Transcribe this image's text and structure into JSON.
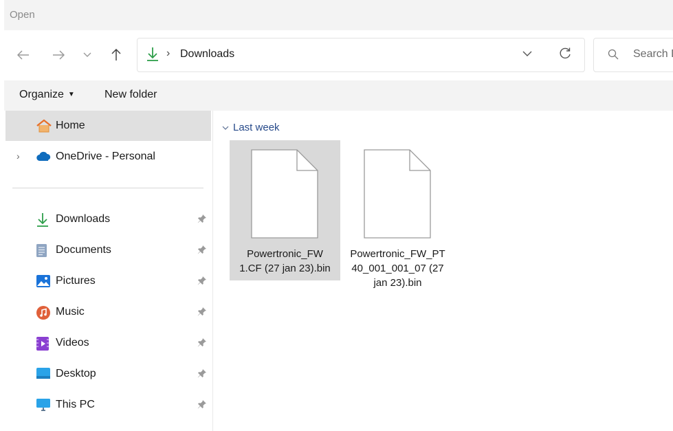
{
  "window": {
    "title": "Open"
  },
  "navigation": {
    "address_crumb": "Downloads",
    "search_placeholder": "Search Downloads"
  },
  "toolbar": {
    "organize_label": "Organize",
    "new_folder_label": "New folder"
  },
  "sidebar": {
    "top_items": [
      {
        "label": "Home",
        "icon": "home-icon",
        "selected": true
      },
      {
        "label": "OneDrive - Personal",
        "icon": "onedrive-icon",
        "expandable": true
      }
    ],
    "quick_access": [
      {
        "label": "Downloads",
        "icon": "downloads-icon",
        "pinned": true
      },
      {
        "label": "Documents",
        "icon": "documents-icon",
        "pinned": true
      },
      {
        "label": "Pictures",
        "icon": "pictures-icon",
        "pinned": true
      },
      {
        "label": "Music",
        "icon": "music-icon",
        "pinned": true
      },
      {
        "label": "Videos",
        "icon": "videos-icon",
        "pinned": true
      },
      {
        "label": "Desktop",
        "icon": "desktop-icon",
        "pinned": true
      },
      {
        "label": "This PC",
        "icon": "this-pc-icon",
        "pinned": true
      }
    ]
  },
  "content": {
    "group_label": "Last week",
    "files": [
      {
        "name_lines": [
          "Powertronic_FW",
          "1.CF (27 jan 23).bin"
        ],
        "selected": true,
        "icon": "file-icon"
      },
      {
        "name_lines": [
          "Powertronic_FW_PT",
          "40_001_001_07 (27",
          "jan 23).bin"
        ],
        "selected": false,
        "icon": "file-icon"
      }
    ]
  },
  "colors": {
    "accent_green": "#2e9e4a",
    "selection_gray": "#d9d9d9",
    "group_header_blue": "#274a8a",
    "onedrive_blue": "#0f6cbd"
  }
}
